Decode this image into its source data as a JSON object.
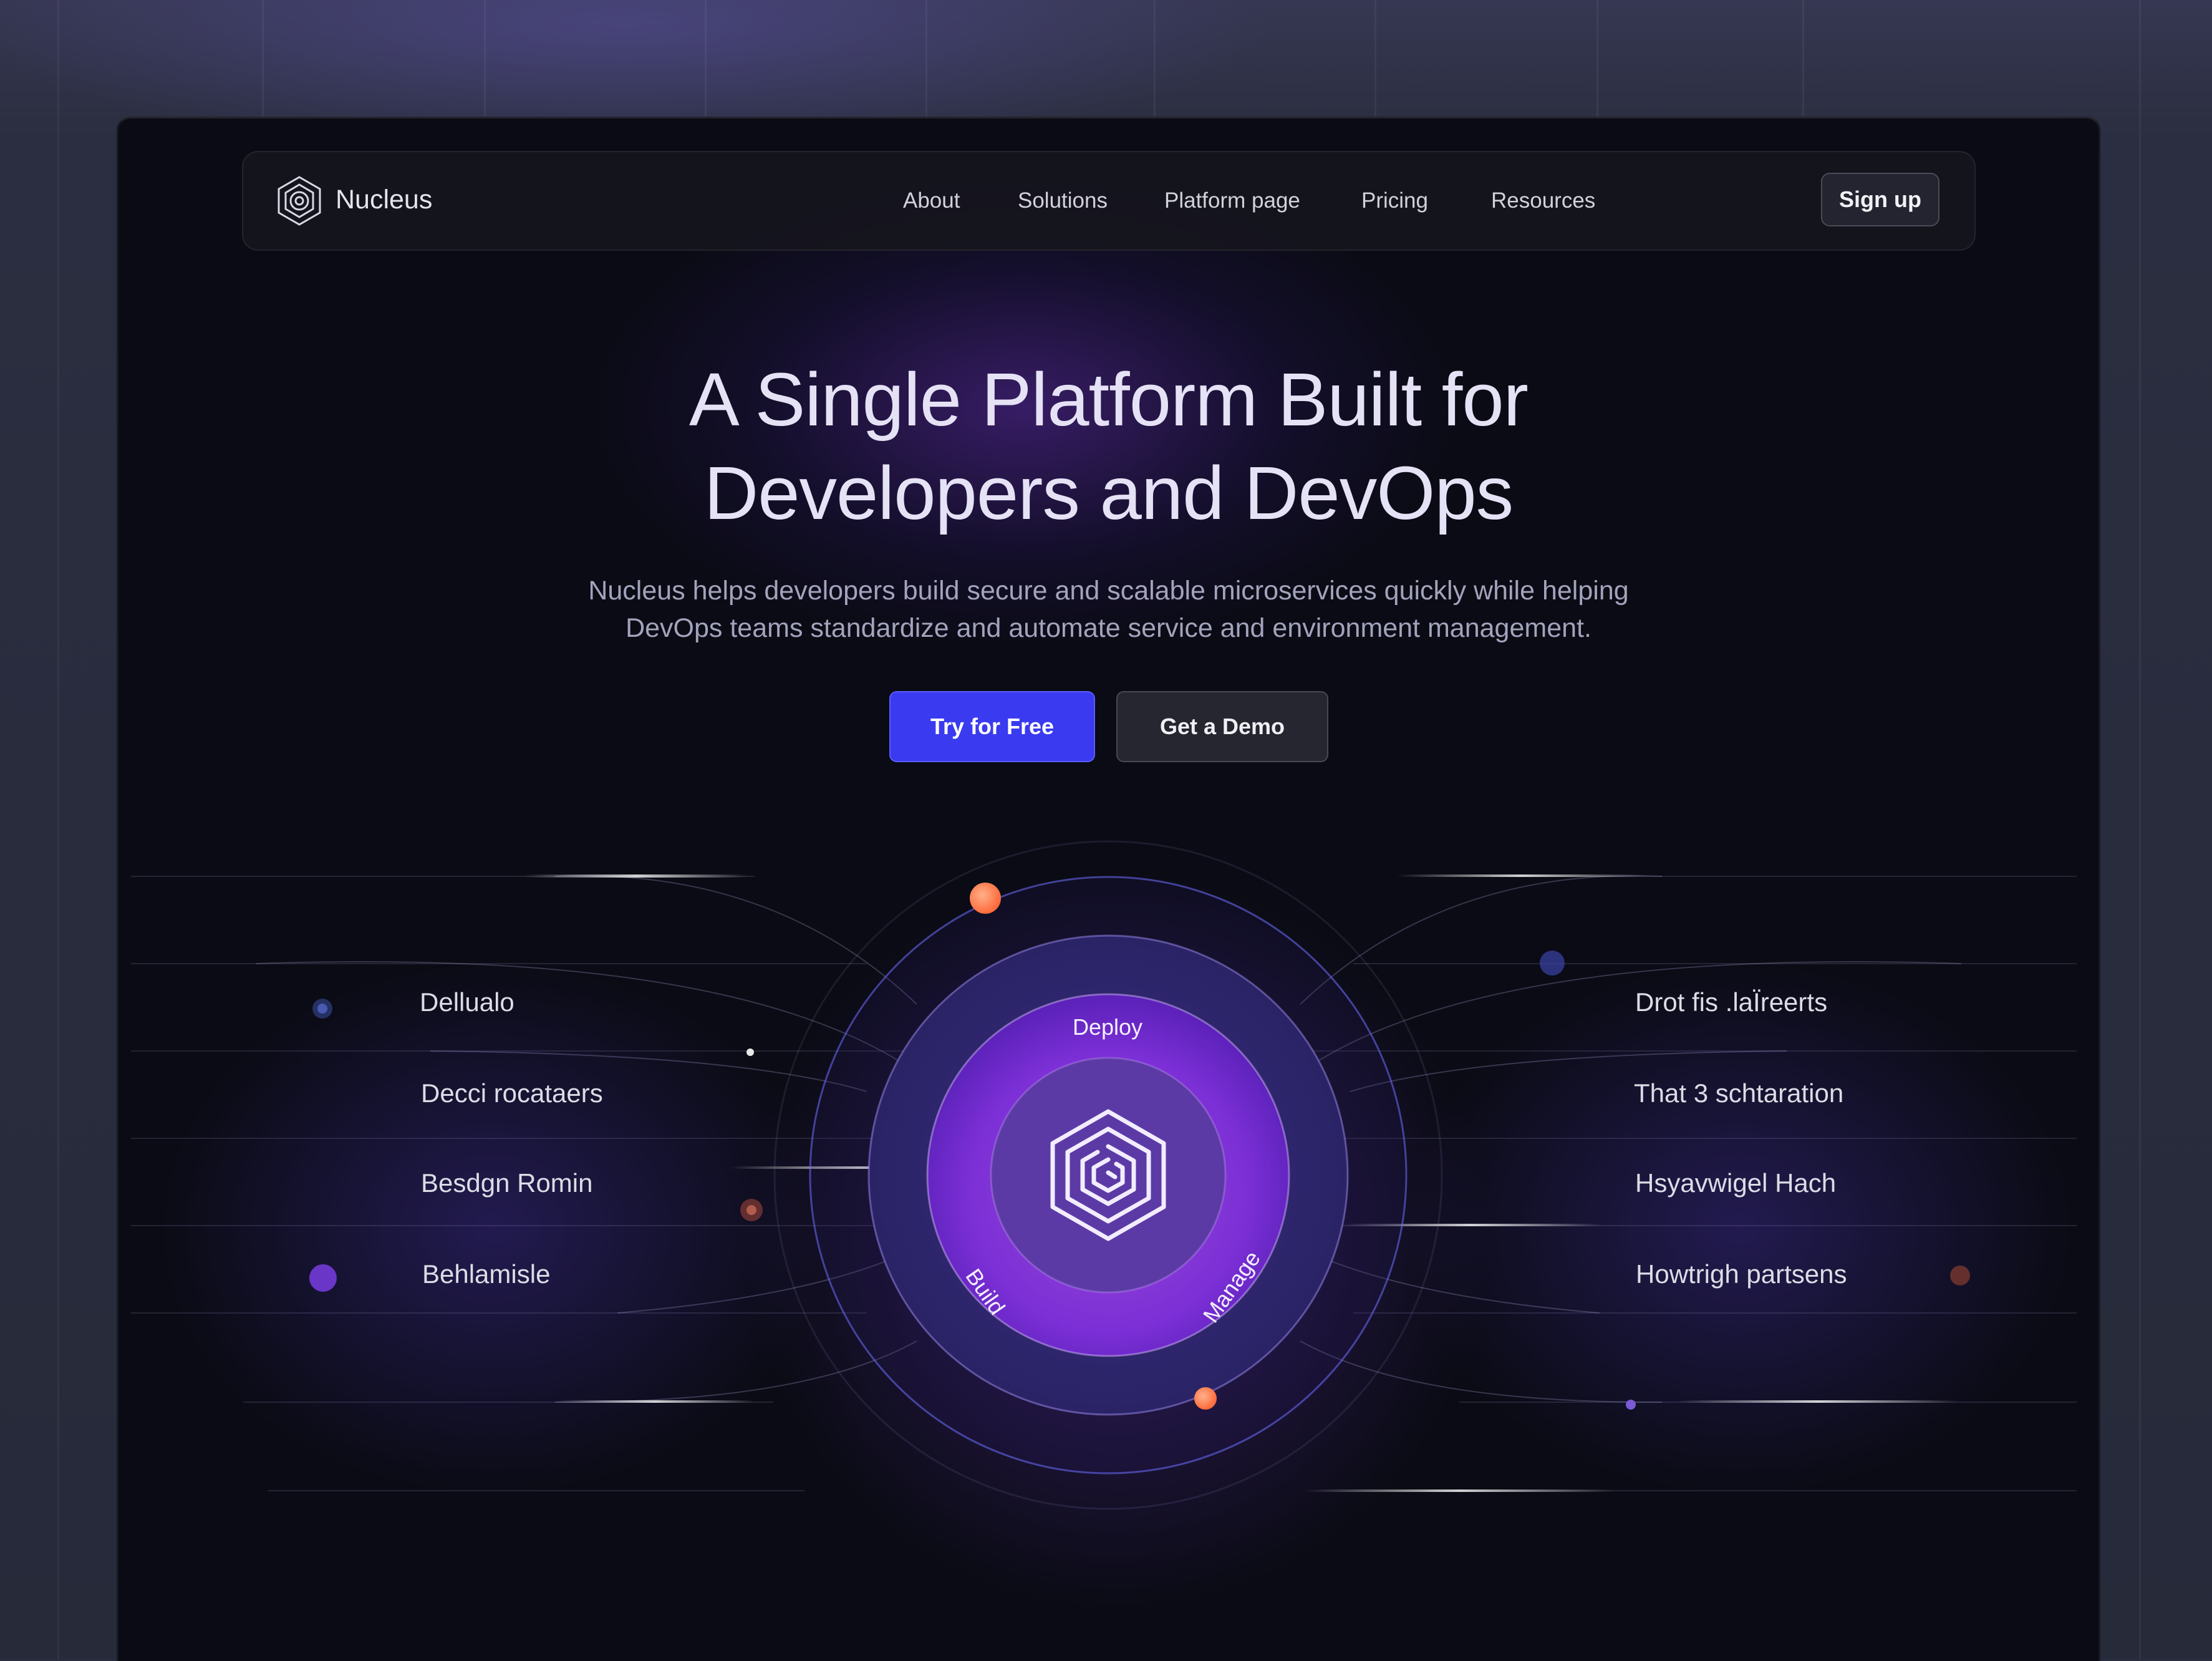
{
  "app": {
    "brand": "Nucleus"
  },
  "nav": {
    "items": [
      "About",
      "Solutions",
      "Platform page",
      "Pricing",
      "Resources"
    ],
    "signup_label": "Sign up"
  },
  "hero": {
    "title_lines": [
      "A Single Platform Built for",
      "Developers and DevOps"
    ],
    "subtitle_lines": [
      "Nucleus helps developers build secure and scalable microservices quickly while helping",
      "DevOps teams standardize and automate service and environment management."
    ],
    "primary_cta": "Try for Free",
    "secondary_cta": "Get a Demo"
  },
  "diagram": {
    "ring_labels": {
      "top": "Deploy",
      "left": "Build",
      "right": "Manage"
    },
    "left_features": [
      "Dellualo",
      "Decci rocataers",
      "Besdgn Romin",
      "Behlamisle"
    ],
    "right_features": [
      "Drot fis .laÏreerts",
      "That 3 schtaration",
      "Hsyavwigel Hach",
      "Howtrigh partsens"
    ]
  },
  "colors": {
    "primary": "#3a3af0",
    "background": "#0a0b14",
    "ring_purple": "#7a2fd0",
    "accent_orange": "#ff7a45"
  }
}
